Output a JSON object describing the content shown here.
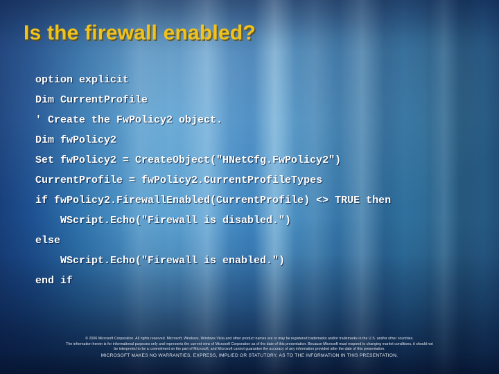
{
  "slide": {
    "title": "Is the firewall enabled?",
    "title_color": "#F2C21C",
    "title_shadow_color": "#604C0A",
    "background_colors": {
      "left_dark": "#18407C",
      "mid_light": "#5BA2D2",
      "right_muted": "#27597F",
      "bottom_dark": "#0F2A52"
    },
    "code_color": "#FFFFFF"
  },
  "code": {
    "language": "VBScript",
    "lines": [
      "option explicit",
      "Dim CurrentProfile",
      "' Create the FwPolicy2 object.",
      "Dim fwPolicy2",
      "Set fwPolicy2 = CreateObject(\"HNetCfg.FwPolicy2\")",
      "CurrentProfile = fwPolicy2.CurrentProfileTypes",
      "if fwPolicy2.FirewallEnabled(CurrentProfile) <> TRUE then",
      "    WScript.Echo(\"Firewall is disabled.\")",
      "else",
      "    WScript.Echo(\"Firewall is enabled.\")",
      "end if"
    ]
  },
  "footer": {
    "lines": [
      "© 2006 Microsoft Corporation. All rights reserved. Microsoft, Windows, Windows Vista and other product names are or may be registered trademarks and/or trademarks in the U.S. and/or other countries.",
      "The information herein is for informational purposes only and represents the current view of Microsoft Corporation as of the date of this presentation.  Because Microsoft must respond to changing market conditions, it should not",
      "be interpreted to be a commitment on the part of Microsoft, and Microsoft cannot guarantee the accuracy of any information provided after the date of this presentation.",
      "MICROSOFT MAKES NO WARRANTIES, EXPRESS, IMPLIED OR STATUTORY, AS TO THE INFORMATION IN THIS PRESENTATION."
    ]
  }
}
